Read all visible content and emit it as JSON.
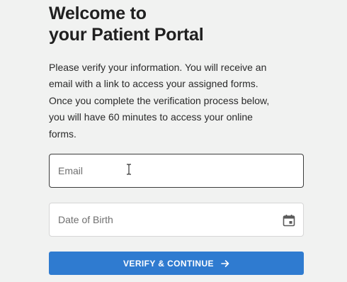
{
  "portal": {
    "title_line1": "Welcome to",
    "title_line2": "your Patient Portal",
    "intro_lines": [
      "Please verify your information. You will receive an",
      "email with a link to access your assigned forms.",
      "Once you complete the verification process below,",
      "you will have 60 minutes to access your online",
      "forms."
    ]
  },
  "form": {
    "email_placeholder": "Email",
    "dob_placeholder": "Date of Birth",
    "verify_label": "VERIFY & CONTINUE"
  },
  "icons": {
    "cursor": "text-cursor-icon",
    "calendar": "calendar-icon",
    "arrow": "arrow-right-icon"
  },
  "colors": {
    "background": "#f1f2f1",
    "button": "#2f7bd0",
    "button_text": "#ffffff"
  }
}
